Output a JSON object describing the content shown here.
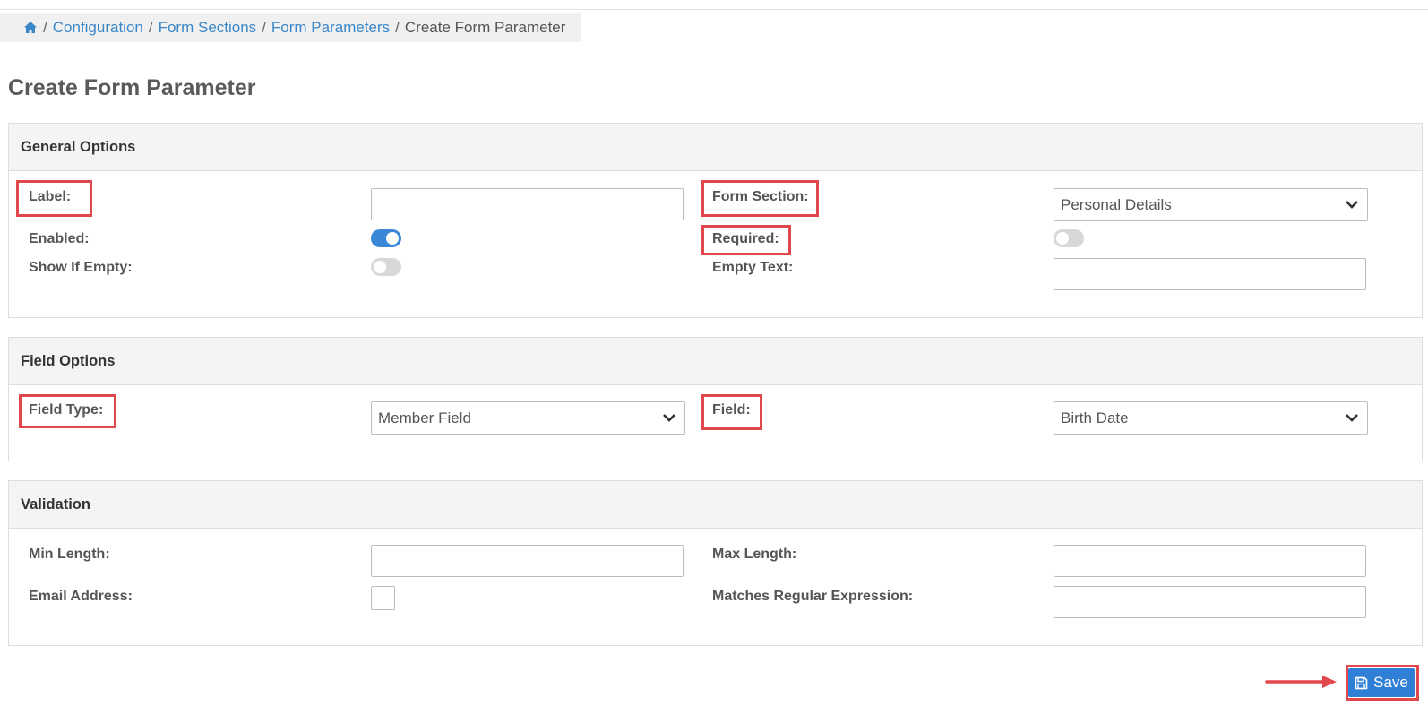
{
  "breadcrumb": {
    "items": [
      "Configuration",
      "Form Sections",
      "Form Parameters"
    ],
    "current": "Create Form Parameter",
    "separator": "/"
  },
  "page": {
    "title": "Create Form Parameter"
  },
  "general": {
    "heading": "General Options",
    "label_label": "Label:",
    "label_value": "",
    "enabled_label": "Enabled:",
    "enabled_on": true,
    "show_if_empty_label": "Show If Empty:",
    "show_if_empty_on": false,
    "form_section_label": "Form Section:",
    "form_section_value": "Personal Details",
    "required_label": "Required:",
    "required_on": false,
    "empty_text_label": "Empty Text:",
    "empty_text_value": ""
  },
  "field_options": {
    "heading": "Field Options",
    "field_type_label": "Field Type:",
    "field_type_value": "Member Field",
    "field_label": "Field:",
    "field_value": "Birth Date"
  },
  "validation": {
    "heading": "Validation",
    "min_length_label": "Min Length:",
    "min_length_value": "",
    "max_length_label": "Max Length:",
    "max_length_value": "",
    "email_label": "Email Address:",
    "email_checked": false,
    "regex_label": "Matches Regular Expression:",
    "regex_value": ""
  },
  "actions": {
    "save_label": "Save"
  },
  "colors": {
    "accent": "#2f7fd6",
    "link": "#3a87c8",
    "highlight": "#e0484b"
  },
  "icons": [
    "home-icon",
    "chevron-down-icon",
    "save-icon",
    "arrow-right-icon"
  ]
}
